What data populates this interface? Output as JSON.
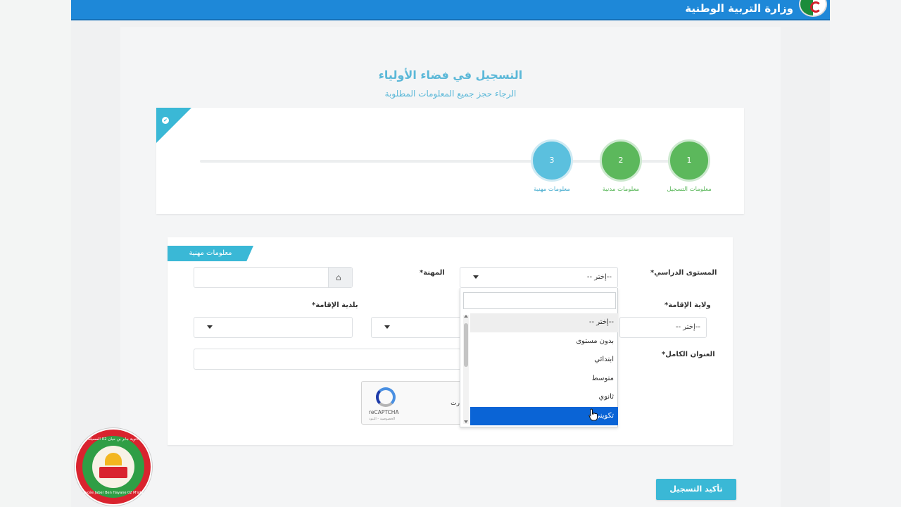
{
  "header": {
    "ministry_name": "وزارة التربية الوطنية"
  },
  "page": {
    "title": "التسجيل في فضاء الأولياء",
    "subtitle": "الرجاء حجز جميع المعلومات المطلوبة"
  },
  "steps": [
    {
      "number": "1",
      "label": "معلومات التسجيل",
      "state": "done"
    },
    {
      "number": "2",
      "label": "معلومات مدنية",
      "state": "done"
    },
    {
      "number": "3",
      "label": "معلومات مهنية",
      "state": "active"
    }
  ],
  "form": {
    "section_title": "معلومات مهنية",
    "education_level_label": "المستوى الدراسي*",
    "education_level_value": "--إختر --",
    "profession_label": "المهنة*",
    "residence_state_label": "ولاية الإقامة*",
    "residence_state_value": "--إختر --",
    "residence_commune_label": "بلدية الإقامة*",
    "full_address_label": "العنوان الكامل*",
    "recaptcha_brand": "reCAPTCHA",
    "recaptcha_privacy": "الخصوصية - البنود",
    "recaptcha_partial_text": "رت"
  },
  "dropdown": {
    "options": [
      "--إختر --",
      "بدون مستوى",
      "ابتدائي",
      "متوسط",
      "ثانوي",
      "تكويني"
    ],
    "highlighted_index": 5
  },
  "actions": {
    "submit_label": "تأكيد التسجيل"
  },
  "overlay_logo": {
    "top_text": "ثانوية جابر بن حيان 02 المسيلة",
    "bottom_text": "Lycée Jaber Ben Hayane 02 M'sila"
  },
  "colors": {
    "header_blue": "#1e88d8",
    "accent_cyan": "#3ab8d6",
    "step_done_green": "#5cb85c",
    "step_active_blue": "#5bc0de",
    "selected_option_blue": "#0a64d6"
  }
}
